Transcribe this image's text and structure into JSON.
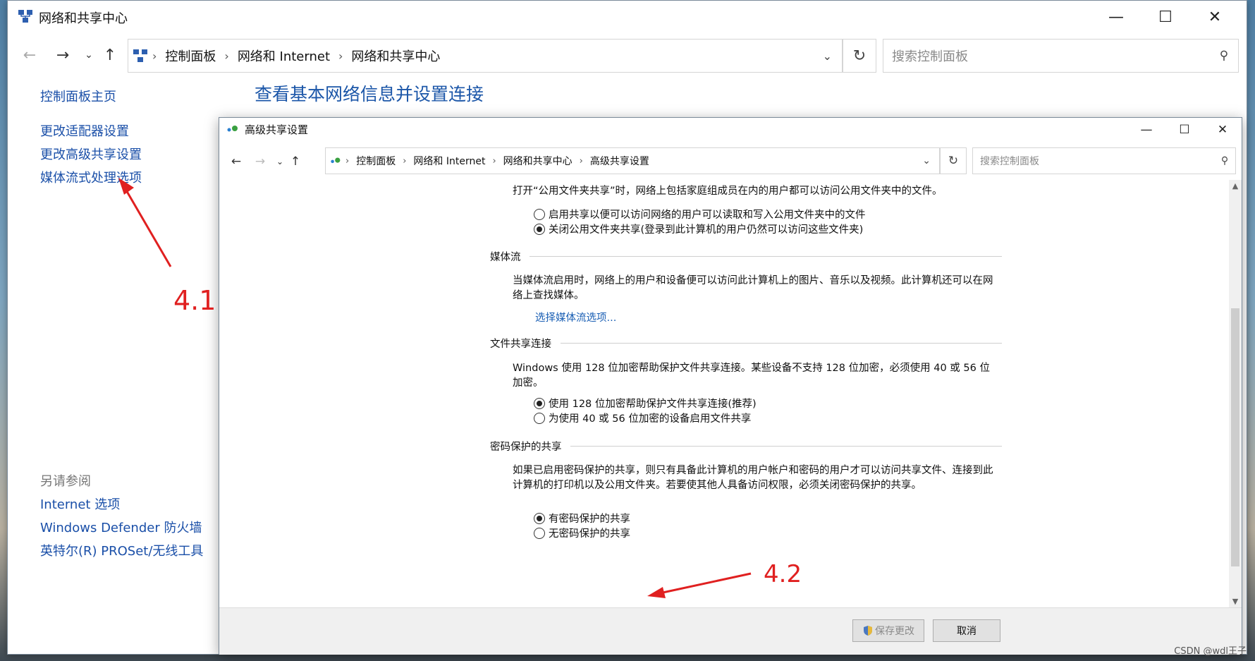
{
  "main_window": {
    "title": "网络和共享中心",
    "breadcrumbs": [
      "控制面板",
      "网络和 Internet",
      "网络和共享中心"
    ],
    "search_placeholder": "搜索控制面板",
    "heading": "查看基本网络信息并设置连接",
    "sidebar": {
      "home": "控制面板主页",
      "items": [
        "更改适配器设置",
        "更改高级共享设置",
        "媒体流式处理选项"
      ],
      "see_also_title": "另请参阅",
      "see_also": [
        "Internet 选项",
        "Windows Defender 防火墙",
        "英特尔(R) PROSet/无线工具"
      ]
    }
  },
  "dialog": {
    "title": "高级共享设置",
    "breadcrumbs": [
      "控制面板",
      "网络和 Internet",
      "网络和共享中心",
      "高级共享设置"
    ],
    "search_placeholder": "搜索控制面板",
    "public_folder": {
      "intro": "打开“公用文件夹共享”时，网络上包括家庭组成员在内的用户都可以访问公用文件夹中的文件。",
      "options": [
        {
          "label": "启用共享以便可以访问网络的用户可以读取和写入公用文件夹中的文件",
          "selected": false
        },
        {
          "label": "关闭公用文件夹共享(登录到此计算机的用户仍然可以访问这些文件夹)",
          "selected": true
        }
      ]
    },
    "media": {
      "title": "媒体流",
      "text": "当媒体流启用时，网络上的用户和设备便可以访问此计算机上的图片、音乐以及视频。此计算机还可以在网络上查找媒体。",
      "link": "选择媒体流选项..."
    },
    "file_sharing": {
      "title": "文件共享连接",
      "text": "Windows 使用 128 位加密帮助保护文件共享连接。某些设备不支持 128 位加密，必须使用 40 或 56 位加密。",
      "options": [
        {
          "label": "使用 128 位加密帮助保护文件共享连接(推荐)",
          "selected": true
        },
        {
          "label": "为使用 40 或 56 位加密的设备启用文件共享",
          "selected": false
        }
      ]
    },
    "password": {
      "title": "密码保护的共享",
      "text": "如果已启用密码保护的共享，则只有具备此计算机的用户帐户和密码的用户才可以访问共享文件、连接到此计算机的打印机以及公用文件夹。若要使其他人具备访问权限，必须关闭密码保护的共享。",
      "options": [
        {
          "label": "有密码保护的共享",
          "selected": true
        },
        {
          "label": "无密码保护的共享",
          "selected": false
        }
      ]
    },
    "buttons": {
      "save": "保存更改",
      "cancel": "取消"
    }
  },
  "annotations": {
    "a1": "4.1",
    "a2": "4.2",
    "color": "#e02020"
  },
  "watermark": "CSDN @wdl王子"
}
